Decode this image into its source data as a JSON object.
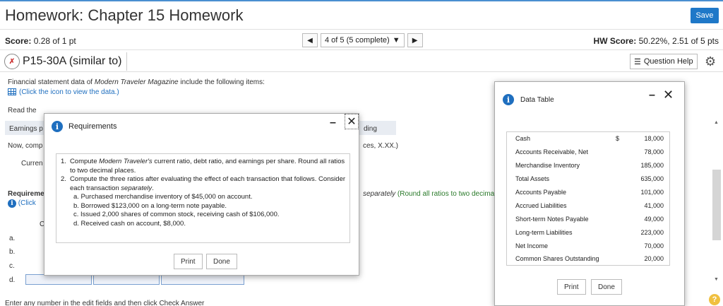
{
  "header": {
    "title": "Homework: Chapter 15 Homework",
    "save_label": "Save"
  },
  "status": {
    "score_label": "Score:",
    "score_value": "0.28 of 1 pt",
    "nav_prev": "◀",
    "nav_position": "4 of 5 (5 complete)",
    "nav_dropdown": "▼",
    "nav_next": "▶",
    "hw_score_label": "HW Score:",
    "hw_score_value": "50.22%, 2.51 of 5 pts"
  },
  "question": {
    "id": "P15-30A (similar to)",
    "help_label": "Question Help",
    "intro_prefix": "Financial statement data of ",
    "intro_italic": "Modern Traveler Magazine",
    "intro_suffix": " include the following items:",
    "data_link": "(Click the icon to view the data.)",
    "read_the": "Read the",
    "earnings_partial": "Earnings p",
    "now_partial": "Now, comp",
    "cutoff_ding": "ding",
    "cutoff_xx": "ces, X.XX.)",
    "current_partial": "Curren",
    "requirements_partial": "Requireme",
    "click_partial": "(Click",
    "separately_italic": "separately",
    "round_note": " (Round all ratios to two decima",
    "c_partial": "C",
    "row_labels": [
      "a.",
      "b.",
      "c.",
      "d."
    ],
    "footer_text": "Enter any number in the edit fields and then click Check Answer"
  },
  "requirements_modal": {
    "title": "Requirements",
    "items": [
      {
        "num": "1.",
        "text_prefix": "Compute ",
        "text_italic": "Modern Traveler's",
        "text_suffix": " current ratio, debt ratio, and earnings per share. Round all ratios to two decimal places."
      },
      {
        "num": "2.",
        "text_prefix": "Compute the three ratios after evaluating the effect of each transaction that follows. Consider each transaction ",
        "text_italic": "separately",
        "text_suffix": "."
      }
    ],
    "sub_items": [
      "a. Purchased merchandise inventory of $45,000 on account.",
      "b. Borrowed $123,000 on a long-term note payable.",
      "c. Issued 2,000 shares of common stock, receiving cash of $106,000.",
      "d. Received cash on account, $8,000."
    ],
    "print_label": "Print",
    "done_label": "Done"
  },
  "data_modal": {
    "title": "Data Table",
    "rows": [
      {
        "label": "Cash",
        "symbol": "$",
        "value": "18,000"
      },
      {
        "label": "Accounts Receivable, Net",
        "symbol": "",
        "value": "78,000"
      },
      {
        "label": "Merchandise Inventory",
        "symbol": "",
        "value": "185,000"
      },
      {
        "label": "Total Assets",
        "symbol": "",
        "value": "635,000"
      },
      {
        "label": "Accounts Payable",
        "symbol": "",
        "value": "101,000"
      },
      {
        "label": "Accrued Liabilities",
        "symbol": "",
        "value": "41,000"
      },
      {
        "label": "Short-term Notes Payable",
        "symbol": "",
        "value": "49,000"
      },
      {
        "label": "Long-term Liabilities",
        "symbol": "",
        "value": "223,000"
      },
      {
        "label": "Net Income",
        "symbol": "",
        "value": "70,000"
      },
      {
        "label": "Common Shares Outstanding",
        "symbol": "",
        "value": "20,000"
      }
    ],
    "print_label": "Print",
    "done_label": "Done"
  },
  "colors": {
    "accent": "#1f78c8",
    "link": "#1f6fbf",
    "help_icon": "#f0c040"
  }
}
